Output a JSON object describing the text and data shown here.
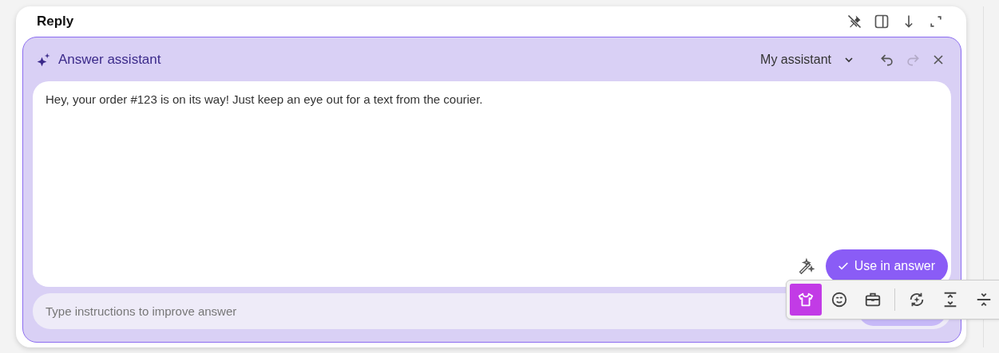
{
  "card": {
    "title": "Reply"
  },
  "assistant": {
    "title": "Answer assistant",
    "selector": "My assistant",
    "undo": {
      "disabled": false
    },
    "redo": {
      "disabled": true
    },
    "answer": "Hey, your order #123 is on its way! Just keep an eye out for a text from the courier.",
    "use_button": "Use in answer",
    "instructions": {
      "placeholder": "Type instructions to improve answer"
    }
  },
  "tone_toolbar": {
    "groups": [
      [
        {
          "kind": "casual",
          "selected": true
        },
        {
          "kind": "friendly",
          "selected": false
        },
        {
          "kind": "formal",
          "selected": false
        }
      ],
      [
        {
          "kind": "rephrase",
          "selected": false
        },
        {
          "kind": "expand",
          "selected": false
        },
        {
          "kind": "shorten",
          "selected": false
        }
      ]
    ]
  }
}
